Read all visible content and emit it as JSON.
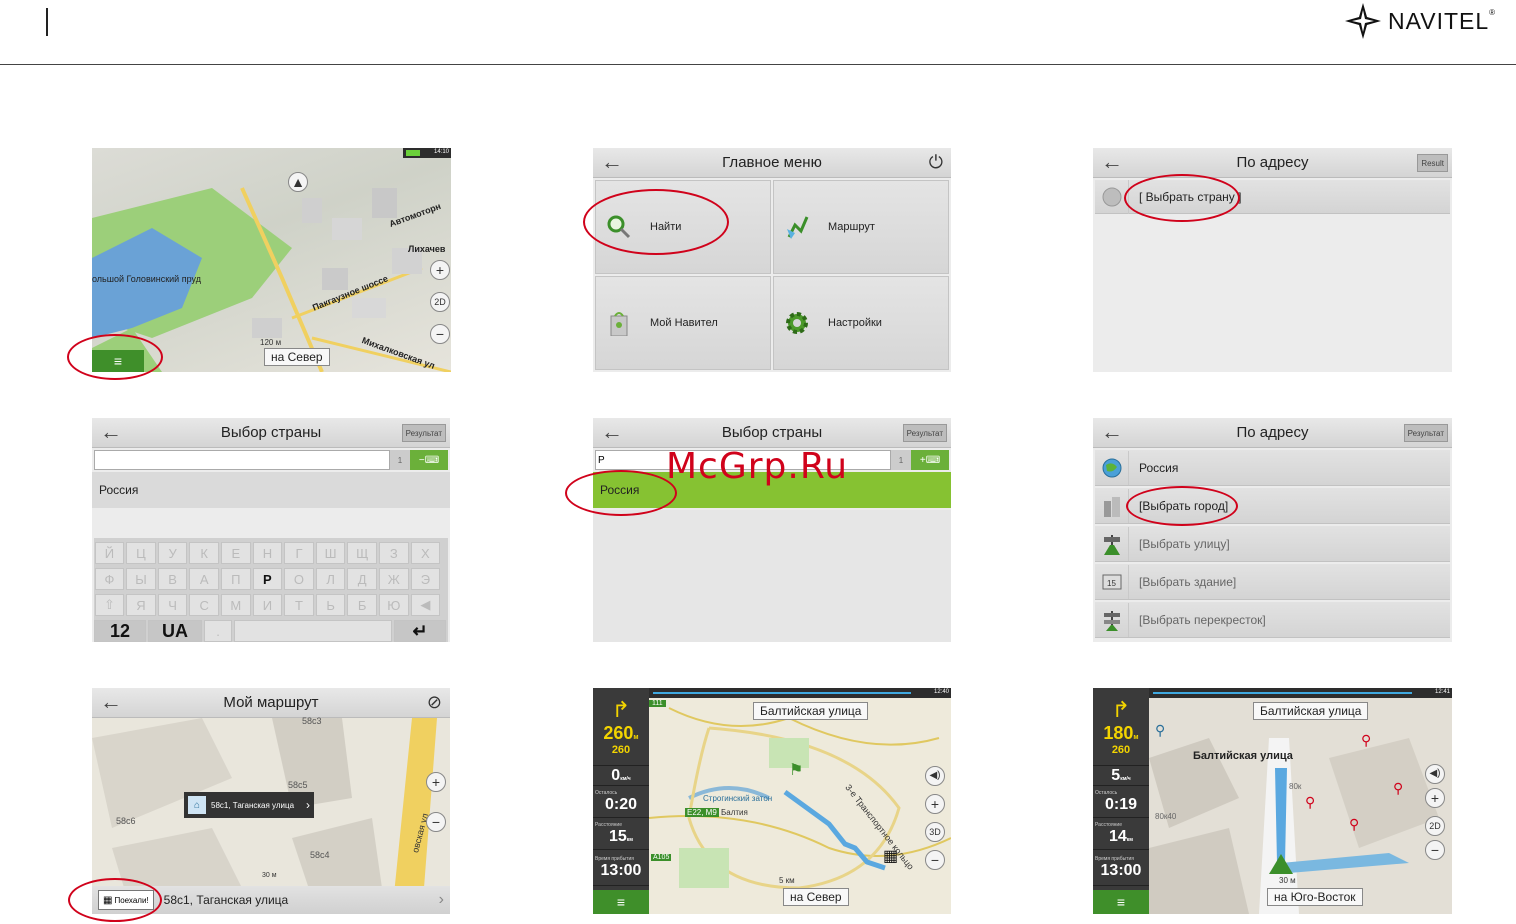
{
  "header": {
    "brand": "NAVITEL",
    "brand_mark": "®"
  },
  "watermark": "McGrp.Ru",
  "screen1": {
    "status_time": "14:10",
    "roads": [
      "Автомоторн",
      "Лихачев",
      "ольшой Головинский пруд",
      "Пакгаузное шоссе",
      "Михалковская ул"
    ],
    "scale": "120 м",
    "direction": "на Север",
    "btn_2d": "2D",
    "menu_icon": "≡"
  },
  "screen2": {
    "title": "Главное меню",
    "tiles": [
      {
        "label": "Найти"
      },
      {
        "label": "Маршрут"
      },
      {
        "label": "Мой Навител"
      },
      {
        "label": "Настройки"
      }
    ]
  },
  "screen3": {
    "title": "По адресу",
    "result": "Result",
    "row": "[ Выбрать страну ]"
  },
  "screen4": {
    "title": "Выбор страны",
    "result": "Результат",
    "count": "1",
    "item": "Россия",
    "keys_row1": [
      "Й",
      "Ц",
      "У",
      "К",
      "Е",
      "Н",
      "Г",
      "Ш",
      "Щ",
      "З",
      "Х"
    ],
    "keys_row2": [
      "Ф",
      "Ы",
      "В",
      "А",
      "П",
      "Р",
      "О",
      "Л",
      "Д",
      "Ж",
      "Э"
    ],
    "keys_row3": [
      "⇧",
      "Я",
      "Ч",
      "С",
      "М",
      "И",
      "Т",
      "Ь",
      "Б",
      "Ю",
      "◀"
    ],
    "key_num": "12",
    "key_lang": "UA",
    "key_dot": ".",
    "key_enter": "↵"
  },
  "screen5": {
    "title": "Выбор страны",
    "result": "Результат",
    "input_value": "Р",
    "count": "1",
    "item": "Россия"
  },
  "screen6": {
    "title": "По адресу",
    "result": "Результат",
    "rows": [
      "Россия",
      "[Выбрать город]",
      "[Выбрать улицу]",
      "[Выбрать здание]",
      "[Выбрать перекресток]"
    ]
  },
  "screen7": {
    "title": "Мой маршрут",
    "popup": "58с1, Таганская улица",
    "labels": [
      "58с3",
      "58с5",
      "58с6",
      "58с4"
    ],
    "scale": "30 м",
    "go_button": "Поехали!",
    "bottom_address": "58с1, Таганская улица",
    "road_label": "овская ул"
  },
  "screen8": {
    "time": "12:40",
    "dist": "260",
    "dist_unit": "м",
    "dist_sub": "260",
    "speed": "0",
    "speed_unit": "км/ч",
    "remain_label": "Осталось",
    "remain": "0:20",
    "distance_label": "Расстояние",
    "distance": "15",
    "distance_unit": "км",
    "arrival_label": "Время прибытия",
    "arrival": "13:00",
    "street": "Балтийская улица",
    "road_tag": "111",
    "labels": [
      "Строгинский затон",
      "E22, M9",
      "Балтия",
      "A105",
      "3-е Транспортное кольцо"
    ],
    "scale": "5 км",
    "direction": "на Север",
    "btn_3d": "3D"
  },
  "screen9": {
    "time": "12:41",
    "dist": "180",
    "dist_unit": "м",
    "dist_sub": "260",
    "speed": "5",
    "speed_unit": "км/ч",
    "remain_label": "Осталось",
    "remain": "0:19",
    "distance_label": "Расстояние",
    "distance": "14",
    "distance_unit": "км",
    "arrival_label": "Время прибытия",
    "arrival": "13:00",
    "street": "Балтийская улица",
    "street_label": "Балтийская улица",
    "labels": [
      "80к40",
      "80к"
    ],
    "scale": "30 м",
    "direction": "на Юго-Восток",
    "btn_2d": "2D"
  }
}
